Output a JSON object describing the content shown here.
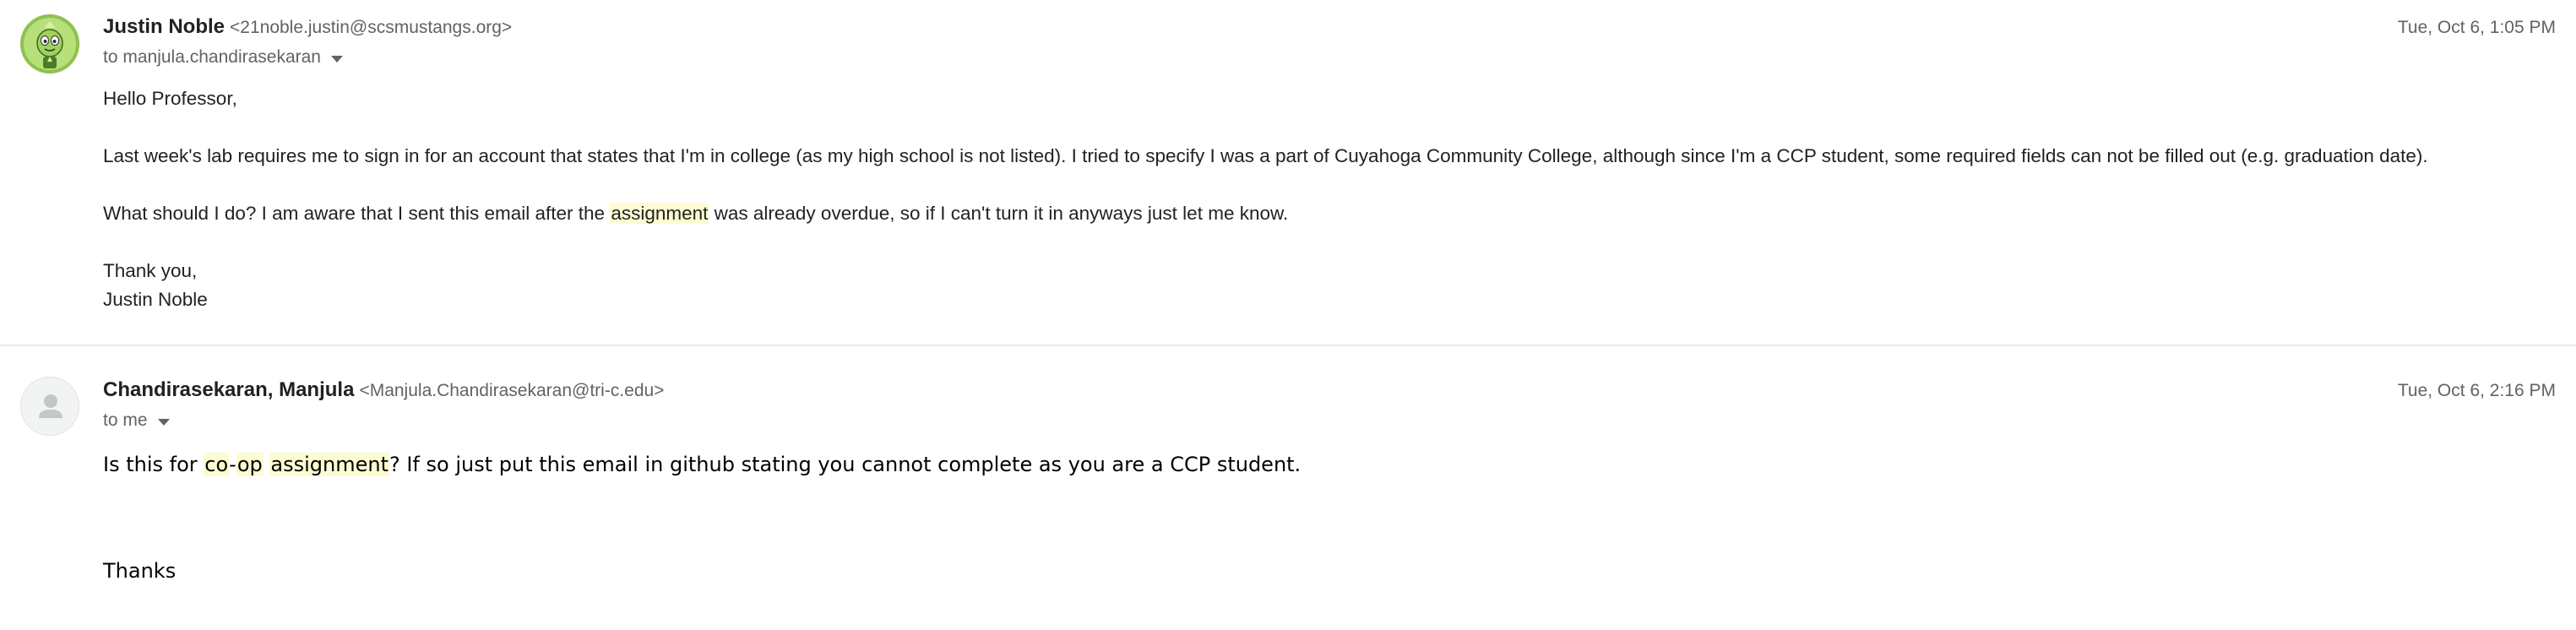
{
  "messages": [
    {
      "sender_name": "Justin Noble",
      "sender_email": "<21noble.justin@scsmustangs.org>",
      "recipient": "to manjula.chandirasekaran",
      "timestamp": "Tue, Oct 6, 1:05 PM",
      "body": {
        "greeting": "Hello Professor,",
        "paragraph1": "Last week's lab requires me to sign in for an account that states that I'm in college (as my high school is not listed). I tried to specify I was a part of Cuyahoga Community College, although since I'm a CCP student, some required fields can not be filled out (e.g. graduation date).",
        "paragraph2_before": "What should I do? I am aware that I sent this email after the ",
        "paragraph2_highlight": "assignment",
        "paragraph2_after": " was already overdue, so if I can't turn it in anyways just let me know.",
        "signoff": "Thank you,",
        "signature": "Justin Noble"
      }
    },
    {
      "sender_name": "Chandirasekaran, Manjula",
      "sender_email": "<Manjula.Chandirasekaran@tri-c.edu>",
      "recipient": "to me",
      "timestamp": "Tue, Oct 6, 2:16 PM",
      "body": {
        "line1_before": "Is this for ",
        "line1_highlight1": "co",
        "line1_dash": "-",
        "line1_highlight2": "op",
        "line1_space": " ",
        "line1_highlight3": "assignment",
        "line1_after": "? If so just put this email in github stating you cannot complete as you are a CCP student.",
        "closing": "Thanks"
      }
    }
  ],
  "icons": {
    "sender1_avatar": "cartoon-gem-character-avatar",
    "sender2_avatar": "default-person-avatar",
    "recipient_details": "caret-down-icon"
  },
  "colors": {
    "highlight": "#fdfbd1",
    "secondary_text": "#5f6368",
    "divider": "#e8eaed"
  }
}
